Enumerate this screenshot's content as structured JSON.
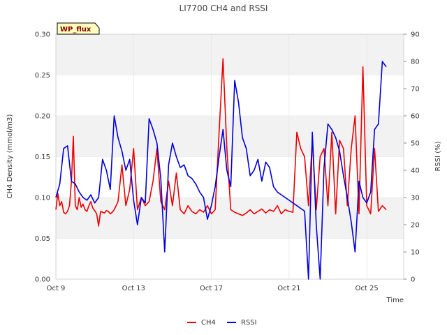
{
  "chart_data": {
    "type": "line",
    "title": "LI7700 CH4 and RSSI",
    "xlabel": "Time",
    "ylabel": "CH4 Density (mmol/m3)",
    "y2label": "RSSI (%)",
    "badge": "WP_flux",
    "x_range": [
      "2024-10-09",
      "2024-10-27"
    ],
    "x_ticks": [
      "Oct 9",
      "Oct 13",
      "Oct 17",
      "Oct 21",
      "Oct 25"
    ],
    "x_tick_days": [
      0,
      4,
      8,
      12,
      16
    ],
    "ylim": [
      0,
      0.3
    ],
    "y_ticks": [
      "0.00",
      "0.05",
      "0.10",
      "0.15",
      "0.20",
      "0.25",
      "0.30"
    ],
    "y2lim": [
      0,
      90
    ],
    "y2_ticks": [
      "0",
      "10",
      "20",
      "30",
      "40",
      "50",
      "60",
      "70",
      "80",
      "90"
    ],
    "grid": true,
    "banded_background": true,
    "legend_position": "bottom-center",
    "series": [
      {
        "name": "CH4",
        "axis": "left",
        "color": "#ee0000",
        "x": [
          0.0,
          0.1,
          0.2,
          0.3,
          0.4,
          0.5,
          0.6,
          0.7,
          0.8,
          0.9,
          1.0,
          1.1,
          1.2,
          1.3,
          1.4,
          1.5,
          1.6,
          1.7,
          1.8,
          1.9,
          2.0,
          2.1,
          2.2,
          2.3,
          2.4,
          2.5,
          2.6,
          2.7,
          2.8,
          2.9,
          3.0,
          3.2,
          3.4,
          3.6,
          3.8,
          4.0,
          4.2,
          4.4,
          4.6,
          4.8,
          5.0,
          5.2,
          5.4,
          5.6,
          5.8,
          6.0,
          6.2,
          6.4,
          6.6,
          6.8,
          7.0,
          7.2,
          7.4,
          7.6,
          7.8,
          8.0,
          8.2,
          8.4,
          8.6,
          8.8,
          9.0,
          9.2,
          9.4,
          9.6,
          9.8,
          10.0,
          10.2,
          10.4,
          10.6,
          10.8,
          11.0,
          11.2,
          11.4,
          11.6,
          11.8,
          12.0,
          12.2,
          12.4,
          12.6,
          12.8,
          13.0,
          13.2,
          13.4,
          13.6,
          13.8,
          14.0,
          14.2,
          14.4,
          14.6,
          14.8,
          15.0,
          15.2,
          15.4,
          15.6,
          15.8,
          16.0,
          16.2,
          16.4,
          16.6,
          16.8,
          17.0
        ],
        "y": [
          0.085,
          0.105,
          0.09,
          0.095,
          0.082,
          0.08,
          0.083,
          0.09,
          0.12,
          0.175,
          0.09,
          0.085,
          0.1,
          0.088,
          0.092,
          0.085,
          0.083,
          0.09,
          0.095,
          0.087,
          0.084,
          0.08,
          0.065,
          0.083,
          0.082,
          0.081,
          0.084,
          0.083,
          0.08,
          0.082,
          0.085,
          0.095,
          0.14,
          0.09,
          0.11,
          0.16,
          0.085,
          0.1,
          0.09,
          0.095,
          0.12,
          0.16,
          0.095,
          0.085,
          0.12,
          0.09,
          0.13,
          0.085,
          0.08,
          0.09,
          0.083,
          0.08,
          0.085,
          0.082,
          0.09,
          0.08,
          0.085,
          0.18,
          0.27,
          0.16,
          0.085,
          0.082,
          0.08,
          0.078,
          0.081,
          0.085,
          0.08,
          0.083,
          0.086,
          0.081,
          0.085,
          0.083,
          0.09,
          0.08,
          0.085,
          0.083,
          0.082,
          0.18,
          0.16,
          0.15,
          0.09,
          0.17,
          0.085,
          0.15,
          0.16,
          0.09,
          0.18,
          0.08,
          0.17,
          0.16,
          0.09,
          0.16,
          0.2,
          0.08,
          0.26,
          0.09,
          0.08,
          0.16,
          0.083,
          0.09,
          0.085
        ]
      },
      {
        "name": "RSSI",
        "axis": "right",
        "color": "#0000dd",
        "x": [
          0.0,
          0.2,
          0.4,
          0.6,
          0.8,
          1.0,
          1.2,
          1.4,
          1.6,
          1.8,
          2.0,
          2.2,
          2.4,
          2.6,
          2.8,
          3.0,
          3.2,
          3.4,
          3.6,
          3.8,
          4.0,
          4.2,
          4.4,
          4.6,
          4.8,
          5.0,
          5.2,
          5.4,
          5.6,
          5.8,
          6.0,
          6.2,
          6.4,
          6.6,
          6.8,
          7.0,
          7.2,
          7.4,
          7.6,
          7.8,
          8.0,
          8.2,
          8.4,
          8.6,
          8.8,
          9.0,
          9.2,
          9.4,
          9.6,
          9.8,
          10.0,
          10.2,
          10.4,
          10.6,
          10.8,
          11.0,
          11.2,
          11.4,
          11.6,
          11.8,
          12.0,
          12.2,
          12.4,
          12.6,
          12.8,
          13.0,
          13.2,
          13.4,
          13.6,
          13.8,
          14.0,
          14.2,
          14.4,
          14.6,
          14.8,
          15.0,
          15.2,
          15.4,
          15.6,
          15.8,
          16.0,
          16.2,
          16.4,
          16.6,
          16.8,
          17.0
        ],
        "y": [
          30,
          35,
          48,
          49,
          36,
          35,
          32,
          30,
          29,
          31,
          28,
          30,
          44,
          40,
          33,
          60,
          52,
          47,
          40,
          44,
          29,
          20,
          30,
          28,
          59,
          55,
          50,
          37,
          10,
          42,
          50,
          45,
          41,
          42,
          38,
          37,
          35,
          32,
          30,
          22,
          27,
          34,
          45,
          55,
          40,
          34,
          73,
          65,
          52,
          48,
          38,
          40,
          44,
          36,
          43,
          41,
          34,
          32,
          31,
          30,
          29,
          28,
          27,
          26,
          25,
          0,
          54,
          20,
          0,
          41,
          57,
          55,
          52,
          47,
          38,
          30,
          21,
          10,
          36,
          30,
          28,
          32,
          55,
          57,
          80,
          78
        ]
      }
    ]
  }
}
